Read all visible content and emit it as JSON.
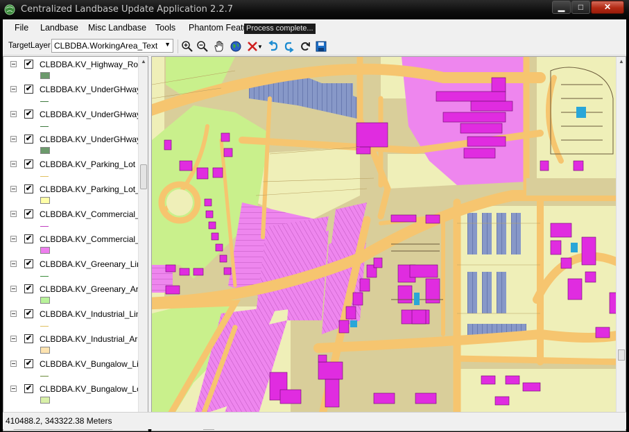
{
  "window": {
    "title": "Centralized Landbase Update Application  2.2.7",
    "minimize": "▁",
    "maximize": "□",
    "close": "✕"
  },
  "menu": {
    "items": [
      "File",
      "Landbase",
      "Misc Landbase",
      "Tools",
      "Phantom Featu"
    ],
    "status_popup": "Process complete..."
  },
  "toolbar": {
    "target_layer_label": "TargetLayer",
    "target_layer_value": "CLBDBA.WorkingArea_Text",
    "icons": [
      "zoom-in-icon",
      "zoom-out-icon",
      "pan-hand-icon",
      "globe-icon",
      "delete-icon",
      "undo-icon",
      "redo-icon",
      "refresh-icon",
      "save-icon"
    ]
  },
  "layers": [
    {
      "name": "CLBDBA.KV_Highway_Road",
      "checked": true,
      "symbol": "box",
      "color": "#6c9a6c"
    },
    {
      "name": "CLBDBA.KV_UnderGHway_",
      "checked": true,
      "symbol": "line",
      "color": "#3f7b3f"
    },
    {
      "name": "CLBDBA.KV_UnderGHway_",
      "checked": true,
      "symbol": "line",
      "color": "#3f7b3f"
    },
    {
      "name": "CLBDBA.KV_UnderGHway_",
      "checked": true,
      "symbol": "box",
      "color": "#6c9a6c"
    },
    {
      "name": "CLBDBA.KV_Parking_Lot",
      "checked": true,
      "symbol": "line",
      "color": "#e0c060"
    },
    {
      "name": "CLBDBA.KV_Parking_Lot_P",
      "checked": true,
      "symbol": "box",
      "color": "#ffffa8"
    },
    {
      "name": "CLBDBA.KV_Commercial_L",
      "checked": true,
      "symbol": "line",
      "color": "#c040c0"
    },
    {
      "name": "CLBDBA.KV_Commercial_A",
      "checked": true,
      "symbol": "box",
      "color": "#ee7eee"
    },
    {
      "name": "CLBDBA.KV_Greenary_Line",
      "checked": true,
      "symbol": "line",
      "color": "#3c8c3c"
    },
    {
      "name": "CLBDBA.KV_Greenary_Area",
      "checked": true,
      "symbol": "box",
      "color": "#b8f29a"
    },
    {
      "name": "CLBDBA.KV_Industrial_Line",
      "checked": true,
      "symbol": "line",
      "color": "#e0c060"
    },
    {
      "name": "CLBDBA.KV_Industrial_Area",
      "checked": true,
      "symbol": "box",
      "color": "#fde3b0"
    },
    {
      "name": "CLBDBA.KV_Bungalow_Lin",
      "checked": true,
      "symbol": "line",
      "color": "#6a8a3a"
    },
    {
      "name": "CLBDBA.KV_Bungalow_Lot",
      "checked": true,
      "symbol": "box",
      "color": "#d8f0a8"
    }
  ],
  "status": {
    "coordinates": "410488.2, 343322.38  Meters"
  },
  "colors": {
    "road": "#f6c56f",
    "land": "#d9ce9a",
    "green": "#c9f08c",
    "commercial": "#ee86ee",
    "building": "#e02ce0",
    "parking": "#8798c8",
    "pale": "#efefb8",
    "water": "#2aa6d8"
  }
}
